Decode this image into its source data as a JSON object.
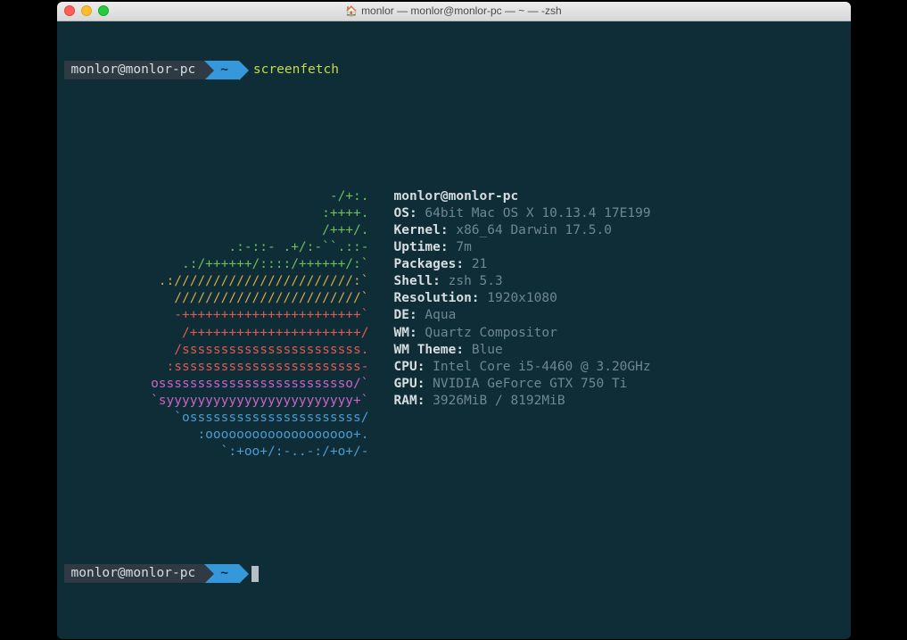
{
  "window": {
    "title": "monlor — monlor@monlor-pc — ~ — -zsh"
  },
  "prompt": {
    "userhost": "monlor@monlor-pc",
    "dir": "~",
    "command": "screenfetch"
  },
  "logo": [
    {
      "text": "-/+:.",
      "color": "green"
    },
    {
      "text": ":++++.",
      "color": "green"
    },
    {
      "text": "/+++/.",
      "color": "green"
    },
    {
      "text": ".:-::- .+/:-``.::-",
      "color": "green"
    },
    {
      "text": ".:/++++++/::::/++++++/:`",
      "color": "green"
    },
    {
      "text": ".:///////////////////////:`",
      "color": "yellow"
    },
    {
      "text": "////////////////////////`",
      "color": "yellow"
    },
    {
      "text": "-+++++++++++++++++++++++`",
      "color": "red"
    },
    {
      "text": "/++++++++++++++++++++++/",
      "color": "red"
    },
    {
      "text": "/sssssssssssssssssssssss.",
      "color": "red"
    },
    {
      "text": ":ssssssssssssssssssssssss-",
      "color": "red"
    },
    {
      "text": "osssssssssssssssssssssssso/`",
      "color": "magenta"
    },
    {
      "text": "`syyyyyyyyyyyyyyyyyyyyyyyy+`",
      "color": "magenta"
    },
    {
      "text": "`ossssssssssssssssssssss/",
      "color": "blue"
    },
    {
      "text": ":ooooooooooooooooooo+.",
      "color": "blue"
    },
    {
      "text": "`:+oo+/:-..-:/+o+/-",
      "color": "blue"
    }
  ],
  "info": {
    "host_line": "monlor@monlor-pc",
    "rows": [
      {
        "label": "OS:",
        "value": "64bit Mac OS X 10.13.4 17E199"
      },
      {
        "label": "Kernel:",
        "value": "x86_64 Darwin 17.5.0"
      },
      {
        "label": "Uptime:",
        "value": "7m"
      },
      {
        "label": "Packages:",
        "value": "21"
      },
      {
        "label": "Shell:",
        "value": "zsh 5.3"
      },
      {
        "label": "Resolution:",
        "value": "1920x1080"
      },
      {
        "label": "DE:",
        "value": "Aqua"
      },
      {
        "label": "WM:",
        "value": "Quartz Compositor"
      },
      {
        "label": "WM Theme:",
        "value": "Blue"
      },
      {
        "label": "CPU:",
        "value": "Intel Core i5-4460 @ 3.20GHz"
      },
      {
        "label": "GPU:",
        "value": "NVIDIA GeForce GTX 750 Ti"
      },
      {
        "label": "RAM:",
        "value": "3926MiB / 8192MiB"
      }
    ]
  }
}
